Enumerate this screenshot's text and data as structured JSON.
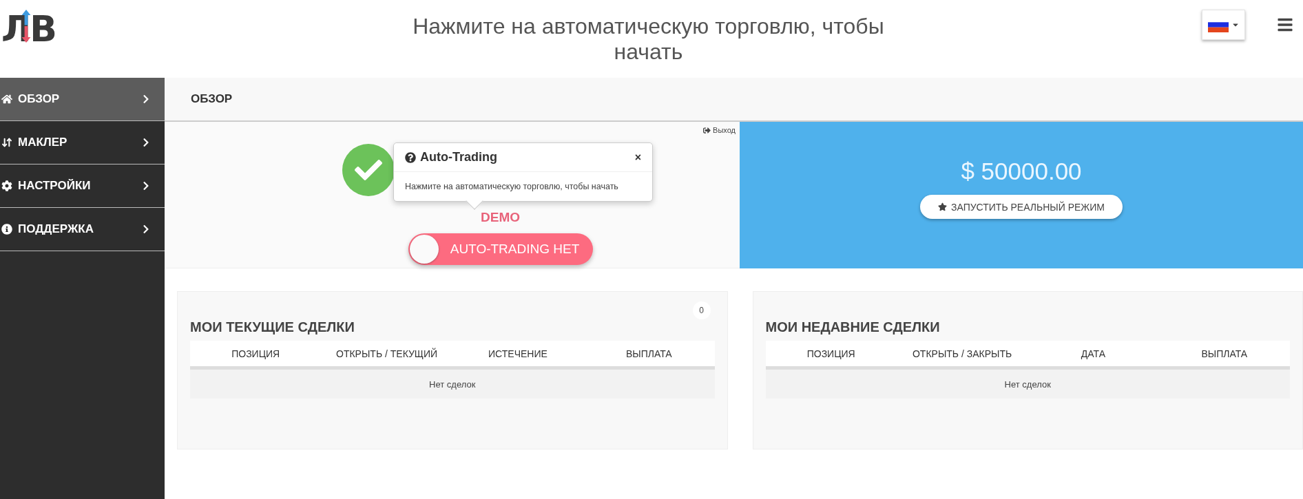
{
  "logo": {
    "text": "ЛВ"
  },
  "header": {
    "title": "Нажмите на автоматическую торговлю, чтобы начать",
    "language": {
      "kind": "dropdown"
    }
  },
  "sidebar": {
    "items": [
      {
        "kind": "home",
        "label": "ОБЗОР",
        "selected": true
      },
      {
        "kind": "sort",
        "label": "МАКЛЕР",
        "selected": false
      },
      {
        "kind": "gear",
        "label": "НАСТРОЙКИ",
        "selected": false
      },
      {
        "kind": "info",
        "label": "ПОДДЕРЖКА",
        "selected": false
      }
    ]
  },
  "page_title": "ОБЗОР",
  "account": {
    "logout": "Выход",
    "mode": "DEMO",
    "toggle": {
      "label": "AUTO-TRADING НЕТ",
      "on": false
    },
    "balance": "$ 50000.00",
    "real_button": "ЗАПУСТИТЬ РЕАЛЬНЫЙ РЕЖИМ"
  },
  "popover": {
    "title": "Auto-Trading",
    "close": "×",
    "text": "Нажмите на автоматическую торговлю, чтобы начать"
  },
  "tables": [
    {
      "title": "МОИ ТЕКУЩИЕ СДЕЛКИ",
      "badge": "0",
      "columns": [
        "ПОЗИЦИЯ",
        "ОТКРЫТЬ / ТЕКУЩИЙ",
        "ИСТЕЧЕНИЕ",
        "ВЫПЛАТА"
      ],
      "empty": "Нет сделок"
    },
    {
      "title": "МОИ НЕДАВНИЕ СДЕЛКИ",
      "columns": [
        "ПОЗИЦИЯ",
        "ОТКРЫТЬ / ЗАКРЫТЬ",
        "ДАТА",
        "ВЫПЛАТА"
      ],
      "empty": "Нет сделок"
    }
  ]
}
